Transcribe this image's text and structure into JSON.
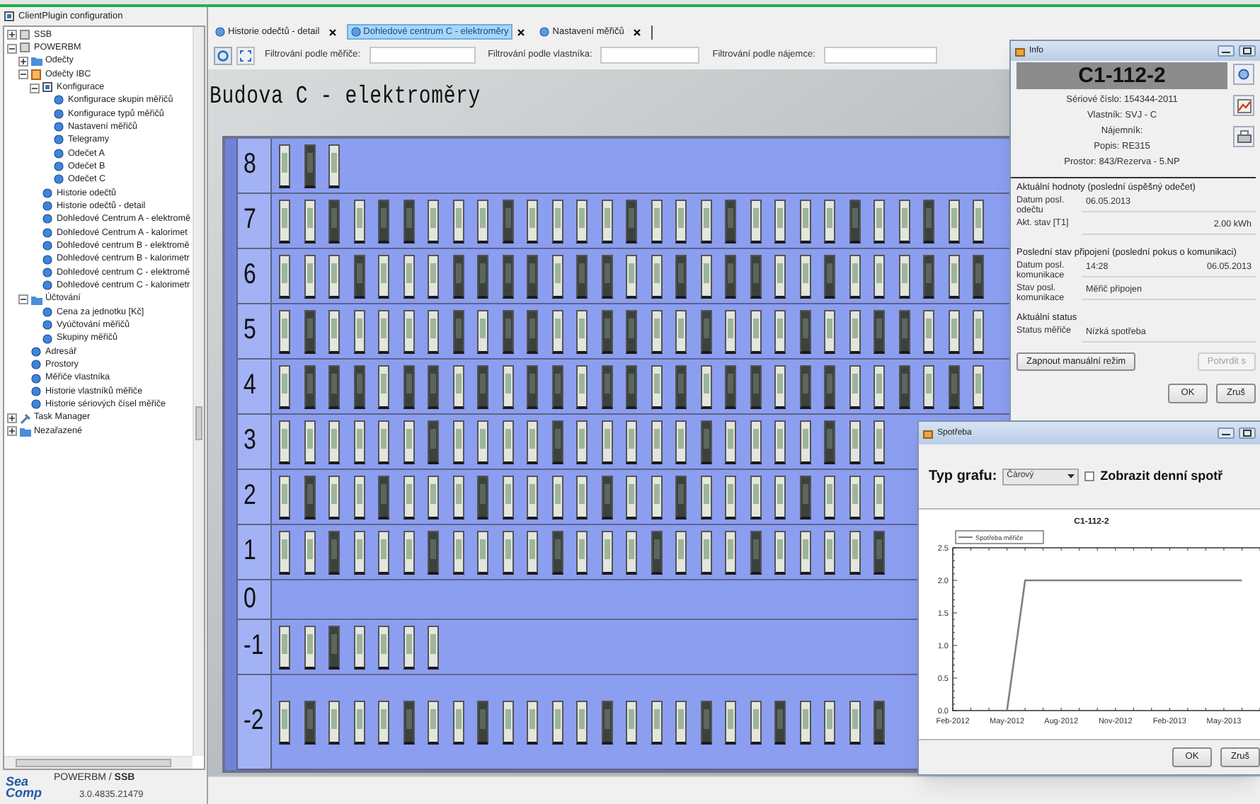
{
  "panel": {
    "title": "ClientPlugin configuration"
  },
  "tree": [
    {
      "label": "SSB",
      "kind": "server",
      "expanded": false
    },
    {
      "label": "POWERBM",
      "kind": "server",
      "expanded": true,
      "children": [
        {
          "label": "Odečty",
          "kind": "folder",
          "expanded": false
        },
        {
          "label": "Odečty IBC",
          "kind": "package",
          "expanded": true,
          "children": [
            {
              "label": "Konfigurace",
              "kind": "config",
              "expanded": true,
              "children": [
                {
                  "label": "Konfigurace skupin měřičů",
                  "kind": "view"
                },
                {
                  "label": "Konfigurace typů měřičů",
                  "kind": "view"
                },
                {
                  "label": "Nastavení měřičů",
                  "kind": "view"
                },
                {
                  "label": "Telegramy",
                  "kind": "view"
                },
                {
                  "label": "Odečet A",
                  "kind": "view"
                },
                {
                  "label": "Odečet B",
                  "kind": "view"
                },
                {
                  "label": "Odečet C",
                  "kind": "view"
                }
              ]
            },
            {
              "label": "Historie odečtů",
              "kind": "view"
            },
            {
              "label": "Historie odečtů - detail",
              "kind": "view"
            },
            {
              "label": "Dohledové Centrum A - elektromě",
              "kind": "view"
            },
            {
              "label": "Dohledové Centrum A - kalorimet",
              "kind": "view"
            },
            {
              "label": "Dohledové centrum B - elektromě",
              "kind": "view"
            },
            {
              "label": "Dohledové centrum B - kalorimetr",
              "kind": "view"
            },
            {
              "label": "Dohledové centrum C - elektromě",
              "kind": "view"
            },
            {
              "label": "Dohledové centrum C - kalorimetr",
              "kind": "view"
            }
          ]
        },
        {
          "label": "Účtování",
          "kind": "folder",
          "expanded": true,
          "children": [
            {
              "label": "Cena za jednotku [Kč]",
              "kind": "view"
            },
            {
              "label": "Vyúčtování měřičů",
              "kind": "view"
            },
            {
              "label": "Skupiny měřičů",
              "kind": "view"
            }
          ]
        },
        {
          "label": "Adresář",
          "kind": "view"
        },
        {
          "label": "Prostory",
          "kind": "view"
        },
        {
          "label": "Měřiče vlastníka",
          "kind": "view"
        },
        {
          "label": "Historie vlastníků měřiče",
          "kind": "view"
        },
        {
          "label": "Historie sériových čísel měřiče",
          "kind": "view"
        }
      ]
    },
    {
      "label": "Task Manager",
      "kind": "tools",
      "expanded": false
    },
    {
      "label": "Nezařazené",
      "kind": "folder",
      "expanded": false
    }
  ],
  "footer": {
    "logo": [
      "Sea",
      "Comp"
    ],
    "app": "POWERBM / **SSB**",
    "version": "3.0.4835.21479"
  },
  "tabs": [
    {
      "label": "Historie odečtů - detail",
      "selected": false
    },
    {
      "label": "Dohledové centrum C - elektroměry",
      "selected": true
    },
    {
      "label": "Nastavení měřičů",
      "selected": false
    }
  ],
  "filters": [
    {
      "label": "Filtrování podle měřiče:"
    },
    {
      "label": "Filtrování podle vlastníka:"
    },
    {
      "label": "Filtrování podle nájemce:"
    }
  ],
  "view_title": "Budova C - elektroměry",
  "floors": [
    {
      "label": "8",
      "meters": [
        {
          "lit": true
        },
        {
          "lit": false
        },
        {
          "lit": true
        }
      ]
    },
    {
      "label": "7",
      "meters": [
        {
          "lit": true
        },
        {
          "lit": true
        },
        {
          "lit": false
        },
        {
          "lit": true
        },
        {
          "lit": false
        },
        {
          "lit": false
        },
        {
          "lit": true
        },
        {
          "lit": true
        },
        {
          "lit": true
        },
        {
          "lit": false
        },
        {
          "lit": true
        },
        {
          "lit": true
        },
        {
          "lit": true
        },
        {
          "lit": true
        },
        {
          "lit": false
        },
        {
          "lit": true
        },
        {
          "lit": true
        },
        {
          "lit": true
        },
        {
          "lit": false
        },
        {
          "lit": true
        },
        {
          "lit": true
        },
        {
          "lit": true
        },
        {
          "lit": true
        },
        {
          "lit": false
        },
        {
          "lit": true
        },
        {
          "lit": true
        },
        {
          "lit": false
        },
        {
          "lit": true
        },
        {
          "lit": true
        }
      ]
    },
    {
      "label": "6",
      "meters": [
        {
          "lit": true
        },
        {
          "lit": true
        },
        {
          "lit": true
        },
        {
          "lit": false
        },
        {
          "lit": true
        },
        {
          "lit": true
        },
        {
          "lit": true
        },
        {
          "lit": false
        },
        {
          "lit": false
        },
        {
          "lit": false
        },
        {
          "lit": false
        },
        {
          "lit": true
        },
        {
          "lit": false
        },
        {
          "lit": false
        },
        {
          "lit": true
        },
        {
          "lit": true
        },
        {
          "lit": false
        },
        {
          "lit": true
        },
        {
          "lit": false
        },
        {
          "lit": false
        },
        {
          "lit": true
        },
        {
          "lit": true
        },
        {
          "lit": false
        },
        {
          "lit": true
        },
        {
          "lit": true
        },
        {
          "lit": true
        },
        {
          "lit": false
        },
        {
          "lit": true
        },
        {
          "lit": false
        }
      ]
    },
    {
      "label": "5",
      "meters": [
        {
          "lit": true
        },
        {
          "lit": false
        },
        {
          "lit": true
        },
        {
          "lit": true
        },
        {
          "lit": true
        },
        {
          "lit": true
        },
        {
          "lit": true
        },
        {
          "lit": false
        },
        {
          "lit": true
        },
        {
          "lit": false
        },
        {
          "lit": false
        },
        {
          "lit": true
        },
        {
          "lit": true
        },
        {
          "lit": false
        },
        {
          "lit": false
        },
        {
          "lit": true
        },
        {
          "lit": true
        },
        {
          "lit": false
        },
        {
          "lit": true
        },
        {
          "lit": true
        },
        {
          "lit": true
        },
        {
          "lit": false
        },
        {
          "lit": true
        },
        {
          "lit": true
        },
        {
          "lit": false
        },
        {
          "lit": false
        },
        {
          "lit": true
        },
        {
          "lit": true
        },
        {
          "lit": true
        }
      ]
    },
    {
      "label": "4",
      "meters": [
        {
          "lit": true
        },
        {
          "lit": false
        },
        {
          "lit": false
        },
        {
          "lit": false
        },
        {
          "lit": true
        },
        {
          "lit": false
        },
        {
          "lit": false
        },
        {
          "lit": true
        },
        {
          "lit": false
        },
        {
          "lit": true
        },
        {
          "lit": false
        },
        {
          "lit": false
        },
        {
          "lit": true
        },
        {
          "lit": false
        },
        {
          "lit": false
        },
        {
          "lit": true
        },
        {
          "lit": false
        },
        {
          "lit": true
        },
        {
          "lit": false
        },
        {
          "lit": false
        },
        {
          "lit": true
        },
        {
          "lit": false
        },
        {
          "lit": false
        },
        {
          "lit": true
        },
        {
          "lit": true
        },
        {
          "lit": false
        },
        {
          "lit": true
        },
        {
          "lit": false
        },
        {
          "lit": true
        }
      ]
    },
    {
      "label": "3",
      "meters": [
        {
          "lit": true
        },
        {
          "lit": true
        },
        {
          "lit": true
        },
        {
          "lit": true
        },
        {
          "lit": true
        },
        {
          "lit": true
        },
        {
          "lit": false
        },
        {
          "lit": true
        },
        {
          "lit": true
        },
        {
          "lit": true
        },
        {
          "lit": true
        },
        {
          "lit": false
        },
        {
          "lit": true
        },
        {
          "lit": true
        },
        {
          "lit": true
        },
        {
          "lit": true
        },
        {
          "lit": true
        },
        {
          "lit": false
        },
        {
          "lit": true
        },
        {
          "lit": true
        },
        {
          "lit": true
        },
        {
          "lit": true
        },
        {
          "lit": false
        },
        {
          "lit": true
        },
        {
          "lit": true
        }
      ]
    },
    {
      "label": "2",
      "meters": [
        {
          "lit": true
        },
        {
          "lit": false
        },
        {
          "lit": true
        },
        {
          "lit": true
        },
        {
          "lit": false
        },
        {
          "lit": true
        },
        {
          "lit": true
        },
        {
          "lit": true
        },
        {
          "lit": false
        },
        {
          "lit": true
        },
        {
          "lit": true
        },
        {
          "lit": true
        },
        {
          "lit": true
        },
        {
          "lit": false
        },
        {
          "lit": true
        },
        {
          "lit": true
        },
        {
          "lit": false
        },
        {
          "lit": true
        },
        {
          "lit": true
        },
        {
          "lit": true
        },
        {
          "lit": true
        },
        {
          "lit": false
        },
        {
          "lit": true
        },
        {
          "lit": true
        },
        {
          "lit": true
        }
      ]
    },
    {
      "label": "1",
      "meters": [
        {
          "lit": true
        },
        {
          "lit": true
        },
        {
          "lit": false
        },
        {
          "lit": true
        },
        {
          "lit": true
        },
        {
          "lit": true
        },
        {
          "lit": false
        },
        {
          "lit": true
        },
        {
          "lit": true
        },
        {
          "lit": true
        },
        {
          "lit": true
        },
        {
          "lit": false
        },
        {
          "lit": true
        },
        {
          "lit": true
        },
        {
          "lit": true
        },
        {
          "lit": false
        },
        {
          "lit": true
        },
        {
          "lit": true
        },
        {
          "lit": true
        },
        {
          "lit": false
        },
        {
          "lit": true
        },
        {
          "lit": true
        },
        {
          "lit": true
        },
        {
          "lit": true
        },
        {
          "lit": false
        }
      ]
    },
    {
      "label": "0"
    },
    {
      "label": "-1",
      "meters": [
        {
          "lit": true
        },
        {
          "lit": true
        },
        {
          "lit": false
        },
        {
          "lit": true
        },
        {
          "lit": true
        },
        {
          "lit": true
        },
        {
          "lit": true
        }
      ]
    },
    {
      "label": "-2",
      "meters": [
        {
          "lit": true
        },
        {
          "lit": false
        },
        {
          "lit": true
        },
        {
          "lit": true
        },
        {
          "lit": true
        },
        {
          "lit": false
        },
        {
          "lit": true
        },
        {
          "lit": true
        },
        {
          "lit": false
        },
        {
          "lit": true
        },
        {
          "lit": true
        },
        {
          "lit": true
        },
        {
          "lit": true
        },
        {
          "lit": false
        },
        {
          "lit": true
        },
        {
          "lit": true
        },
        {
          "lit": true
        },
        {
          "lit": false
        },
        {
          "lit": true
        },
        {
          "lit": true
        },
        {
          "lit": false
        },
        {
          "lit": true
        },
        {
          "lit": true
        },
        {
          "lit": true
        },
        {
          "lit": false
        }
      ]
    }
  ],
  "info_window": {
    "title": "Info",
    "meter": "C1-112-2",
    "details": [
      "Sériové číslo: 154344-2011",
      "Vlastník: SVJ - C",
      "Nájemník:",
      "Popis: RE315",
      "Prostor: 843/Rezerva - 5.NP"
    ],
    "sections": [
      {
        "heading": "Aktuální hodnoty (poslední úspěšný odečet)",
        "fields": [
          {
            "label": "Datum posl. odečtu",
            "kind": "text",
            "values": [
              "06.05.2013"
            ]
          },
          {
            "label": "Akt. stav [T1]",
            "kind": "reading",
            "values": [
              "2.00 kWh"
            ]
          }
        ]
      },
      {
        "heading": "Poslední stav připojení (poslední pokus o komunikaci)",
        "fields": [
          {
            "label": "Datum posl. komunikace",
            "kind": "split",
            "values": [
              "14:28",
              "06.05.2013"
            ]
          },
          {
            "label": "Stav posl. komunikace",
            "kind": "text",
            "values": [
              "Měřič připojen"
            ]
          }
        ]
      },
      {
        "heading": "Aktuální status",
        "fields": [
          {
            "label": "Status měřiče",
            "kind": "text",
            "values": [
              "Nízká spotřeba"
            ]
          }
        ]
      }
    ],
    "actions": [
      {
        "label": "Zapnout manuální režim",
        "disabled": false
      },
      {
        "label": "Potvrdit s",
        "disabled": true
      }
    ],
    "buttons": [
      "OK",
      "Zruš"
    ]
  },
  "chart_window": {
    "title": "Spotřeba",
    "chart_type": {
      "label": "Typ grafu:",
      "value": "Čárový"
    },
    "daily": {
      "label": "Zobrazit denní spotř",
      "checked": false
    },
    "chart_data": {
      "type": "line",
      "title": "C1-112-2",
      "categories": [
        "Feb-2012",
        null,
        null,
        "May-2012",
        null,
        null,
        "Aug-2012",
        null,
        null,
        "Nov-2012",
        null,
        null,
        "Feb-2013",
        null,
        null,
        "May-2013",
        null,
        null
      ],
      "series": [
        {
          "name": "Spotřeba měřiče",
          "color": "#808080",
          "values": [
            null,
            null,
            null,
            0,
            2.0,
            2.0,
            2.0,
            2.0,
            2.0,
            2.0,
            2.0,
            2.0,
            2.0,
            2.0,
            2.0,
            2.0,
            2.0,
            null
          ]
        }
      ],
      "ylim": [
        0,
        2.5
      ],
      "yticks": [
        {
          "value": 0,
          "label": "0.0"
        },
        {
          "value": 0.5,
          "label": "0.5"
        },
        {
          "value": 1,
          "label": "1.0"
        },
        {
          "value": 1.5,
          "label": "1.5"
        },
        {
          "value": 2,
          "label": "2.0"
        },
        {
          "value": 2.5,
          "label": "2.5"
        }
      ]
    },
    "buttons": [
      "OK",
      "Zruš"
    ]
  }
}
